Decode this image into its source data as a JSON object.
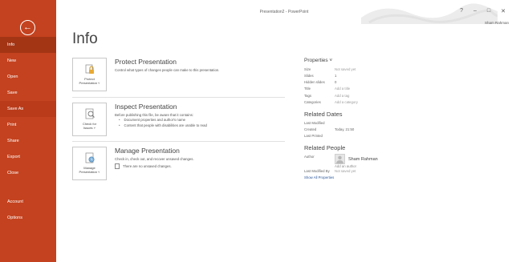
{
  "window": {
    "title": "Presentation2 - PowerPoint",
    "controls": {
      "help": "?",
      "minimize": "–",
      "restore": "□",
      "close": "✕"
    },
    "user": "Sham Rahman"
  },
  "sidebar": {
    "back_icon": "back-arrow-icon",
    "items": [
      {
        "label": "Info",
        "active": true
      },
      {
        "label": "New"
      },
      {
        "label": "Open"
      },
      {
        "label": "Save"
      },
      {
        "label": "Save As"
      },
      {
        "label": "Print"
      },
      {
        "label": "Share"
      },
      {
        "label": "Export"
      },
      {
        "label": "Close"
      }
    ],
    "bottom_items": [
      {
        "label": "Account"
      },
      {
        "label": "Options"
      }
    ]
  },
  "main": {
    "title": "Info",
    "sections": [
      {
        "tile_label": "Protect\nPresentation ˅",
        "heading": "Protect Presentation",
        "description": "Control what types of changes people can make to this presentation."
      },
      {
        "tile_label": "Check for\nIssues ˅",
        "heading": "Inspect Presentation",
        "description": "Before publishing this file, be aware that it contains:",
        "bullets": [
          "Document properties and author's name",
          "Content that people with disabilities are unable to read"
        ]
      },
      {
        "tile_label": "Manage\nPresentation ˅",
        "heading": "Manage Presentation",
        "description": "Check in, check out, and recover unsaved changes.",
        "note": "There are no unsaved changes."
      }
    ]
  },
  "properties": {
    "heading": "Properties ˅",
    "rows": [
      {
        "key": "Size",
        "value": "Not saved yet",
        "muted": true
      },
      {
        "key": "Slides",
        "value": "1"
      },
      {
        "key": "Hidden slides",
        "value": "0"
      },
      {
        "key": "Title",
        "value": "Add a title",
        "muted": true
      },
      {
        "key": "Tags",
        "value": "Add a tag",
        "muted": true
      },
      {
        "key": "Categories",
        "value": "Add a category",
        "muted": true
      }
    ],
    "related_dates": {
      "heading": "Related Dates",
      "rows": [
        {
          "key": "Last Modified",
          "value": ""
        },
        {
          "key": "Created",
          "value": "Today, 21:50"
        },
        {
          "key": "Last Printed",
          "value": ""
        }
      ]
    },
    "related_people": {
      "heading": "Related People",
      "author_key": "Author",
      "author_name": "Sham Rahman",
      "add_author": "Add an author",
      "last_modified_by_key": "Last Modified By",
      "last_modified_by_value": "Not saved yet",
      "show_all": "Show All Properties"
    }
  }
}
